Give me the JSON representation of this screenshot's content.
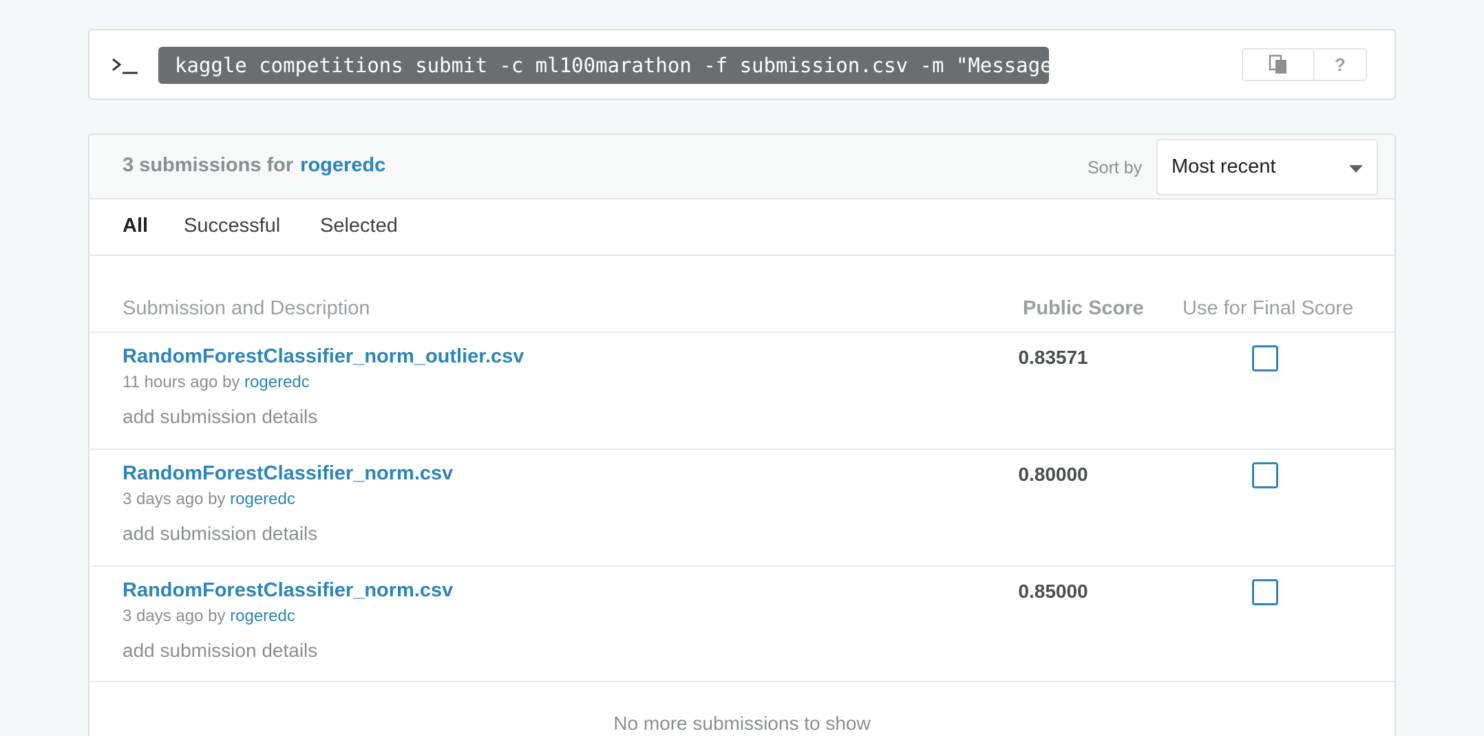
{
  "api": {
    "command": "kaggle competitions submit -c ml100marathon -f submission.csv -m \"Message\"",
    "help_label": "?"
  },
  "submissions": {
    "count_label": "3 submissions for",
    "user": "rogeredc",
    "sort_label": "Sort by",
    "sort_value": "Most recent",
    "tabs": [
      {
        "label": "All"
      },
      {
        "label": "Successful"
      },
      {
        "label": "Selected"
      }
    ],
    "columns": {
      "description": "Submission and Description",
      "public_score": "Public Score",
      "final": "Use for Final Score"
    },
    "rows": [
      {
        "file": "RandomForestClassifier_norm_outlier.csv",
        "time": "11 hours ago",
        "by": "by",
        "user": "rogeredc",
        "details": "add submission details",
        "score": "0.83571"
      },
      {
        "file": "RandomForestClassifier_norm.csv",
        "time": "3 days ago",
        "by": "by",
        "user": "rogeredc",
        "details": "add submission details",
        "score": "0.80000"
      },
      {
        "file": "RandomForestClassifier_norm.csv",
        "time": "3 days ago",
        "by": "by",
        "user": "rogeredc",
        "details": "add submission details",
        "score": "0.85000"
      }
    ],
    "footer": "No more submissions to show"
  },
  "colors": {
    "accent": "#2c84b8",
    "command_bg": "#6b6e70"
  }
}
